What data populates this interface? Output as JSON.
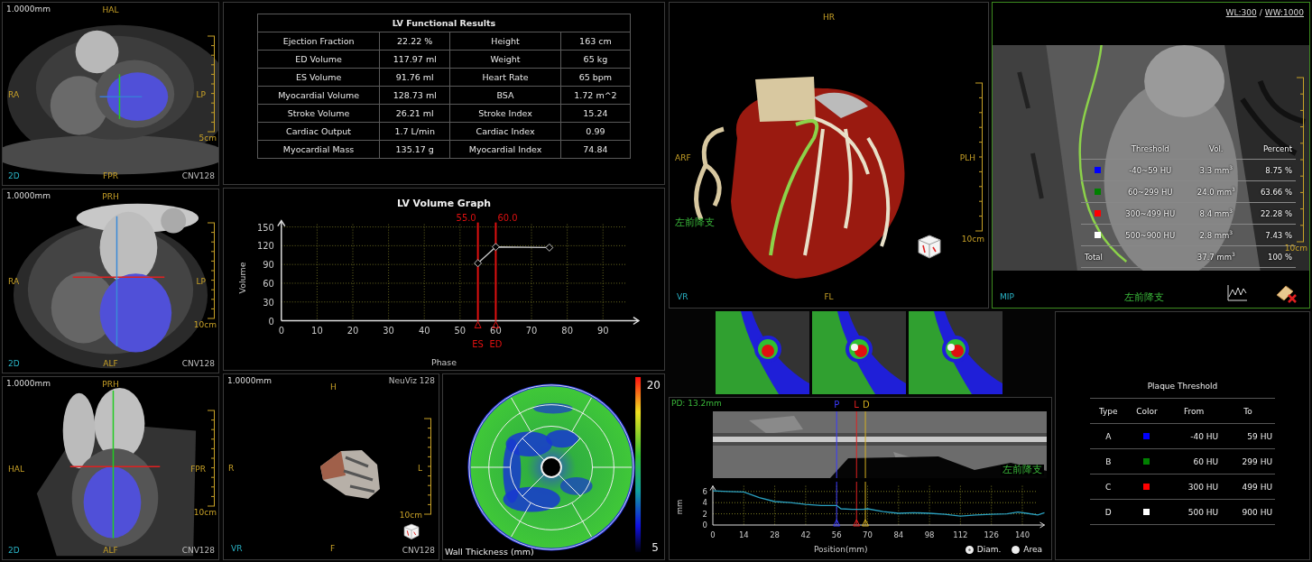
{
  "mpr_views": [
    {
      "kind": "short_axis",
      "spacing": "1.0000mm",
      "top": "HAL",
      "left": "RA",
      "right": "LP",
      "bottom": "FPR",
      "mode": "2D",
      "scanner": "CNV128",
      "ruler": "5cm"
    },
    {
      "kind": "four_chamber",
      "spacing": "1.0000mm",
      "top": "PRH",
      "left": "RA",
      "right": "LP",
      "bottom": "ALF",
      "mode": "2D",
      "scanner": "CNV128",
      "ruler": "10cm"
    },
    {
      "kind": "two_chamber",
      "spacing": "1.0000mm",
      "top": "PRH",
      "left": "HAL",
      "right": "FPR",
      "bottom": "ALF",
      "mode": "2D",
      "scanner": "CNV128",
      "ruler": "10cm"
    }
  ],
  "lv_results": {
    "title": "LV Functional Results",
    "rows": [
      [
        "Ejection Fraction",
        "22.22 %",
        "Height",
        "163 cm"
      ],
      [
        "ED Volume",
        "117.97 ml",
        "Weight",
        "65 kg"
      ],
      [
        "ES Volume",
        "91.76 ml",
        "Heart Rate",
        "65 bpm"
      ],
      [
        "Myocardial Volume",
        "128.73 ml",
        "BSA",
        "1.72 m^2"
      ],
      [
        "Stroke Volume",
        "26.21 ml",
        "Stroke Index",
        "15.24"
      ],
      [
        "Cardiac Output",
        "1.7 L/min",
        "Cardiac Index",
        "0.99"
      ],
      [
        "Myocardial Mass",
        "135.17 g",
        "Myocardial Index",
        "74.84"
      ]
    ]
  },
  "volume_graph": {
    "chart_data": {
      "type": "line",
      "title": "LV Volume Graph",
      "xlabel": "Phase",
      "ylabel": "Volume",
      "x": [
        55,
        60,
        75
      ],
      "series": [
        {
          "color": "#c8c8c8",
          "marker": "diamond",
          "values": [
            92,
            118,
            117
          ]
        }
      ],
      "xlim": [
        0,
        100
      ],
      "ylim": [
        0,
        160
      ],
      "xticks": [
        0,
        10,
        20,
        30,
        40,
        50,
        60,
        70,
        80,
        90
      ],
      "yticks": [
        0,
        30,
        60,
        90,
        120,
        150
      ],
      "grid": true,
      "ref_lines": [
        {
          "axis": "x",
          "value": 55,
          "label": "55.0",
          "color": "#e01010"
        },
        {
          "axis": "x",
          "value": 60,
          "label": "60.0",
          "color": "#e01010"
        }
      ],
      "annotations": [
        "ES",
        "ED"
      ]
    }
  },
  "vr_small": {
    "spacing": "1.0000mm",
    "scanner_model": "NeuViz 128",
    "top": "H",
    "left": "R",
    "right": "L",
    "bottom": "F",
    "mode": "VR",
    "scanner": "CNV128",
    "ruler": "10cm"
  },
  "bullseye": {
    "caption": "Wall Thickness (mm)",
    "scale_max": "20",
    "scale_min": "5"
  },
  "vr_main": {
    "top": "HR",
    "left": "ARF",
    "right": "PLH",
    "bottom": "FL",
    "mode": "VR",
    "vessel_label": "左前降支",
    "ruler": "10cm"
  },
  "mip": {
    "wl": "WL:300",
    "separator": "/",
    "ww": "WW:1000",
    "mode": "MIP",
    "vessel_label": "左前降支",
    "ruler": "10cm",
    "columns": [
      "Threshold",
      "Vol.",
      "Percent"
    ],
    "rows": [
      {
        "color": "#0000ff",
        "range": "-40~59 HU",
        "volume": "3.3 mm$^{3}$",
        "percent": "8.75 %"
      },
      {
        "color": "#008000",
        "range": "60~299 HU",
        "volume": "24.0 mm$^{3}$",
        "percent": "63.66 %"
      },
      {
        "color": "#ff0000",
        "range": "300~499 HU",
        "volume": "8.4 mm$^{3}$",
        "percent": "22.28 %"
      },
      {
        "color": "#ffffff",
        "range": "500~900 HU",
        "volume": "2.8 mm$^{3}$",
        "percent": "7.43 %"
      }
    ],
    "total": {
      "label": "Total",
      "volume": "37.7 mm$^{3}$",
      "percent": "100 %"
    }
  },
  "stretched_view": {
    "label": "PD: 13.2mm",
    "vessel_label": "左前降支"
  },
  "diameter_chart": {
    "chart_data": {
      "type": "line",
      "xlabel": "Position(mm)",
      "ylabel": "mm",
      "x": [
        0,
        7,
        14,
        21,
        28,
        35,
        42,
        49,
        56,
        58,
        63,
        68,
        70,
        77,
        84,
        91,
        98,
        105,
        112,
        119,
        126,
        133,
        138,
        142,
        147,
        150
      ],
      "series": [
        {
          "color": "#2aa0c0",
          "values": [
            6.1,
            6.0,
            5.9,
            4.9,
            4.2,
            4.0,
            3.7,
            3.5,
            3.5,
            2.9,
            2.8,
            2.8,
            2.9,
            2.4,
            2.1,
            2.2,
            2.1,
            1.9,
            1.6,
            1.8,
            1.9,
            2.0,
            2.3,
            2.1,
            1.8,
            2.2
          ]
        }
      ],
      "xlim": [
        0,
        150
      ],
      "ylim": [
        0,
        7
      ],
      "xticks": [
        0,
        14,
        28,
        42,
        56,
        70,
        84,
        98,
        112,
        126,
        140
      ],
      "yticks": [
        0,
        2,
        4,
        6
      ],
      "grid": true,
      "ref_lines": [
        {
          "axis": "x",
          "value": 56,
          "label": "P",
          "color": "#3a3aff"
        },
        {
          "axis": "x",
          "value": 65,
          "label": "L",
          "color": "#e02020"
        },
        {
          "axis": "x",
          "value": 69,
          "label": "D",
          "color": "#d4b020"
        }
      ]
    },
    "legend": [
      {
        "label": "Diam.",
        "selected": true
      },
      {
        "label": "Area",
        "selected": false
      }
    ]
  },
  "plaque_threshold": {
    "title": "Plaque Threshold",
    "columns": [
      "Type",
      "Color",
      "From",
      "To"
    ],
    "rows": [
      {
        "type": "A",
        "color": "#0000ff",
        "from": "-40 HU",
        "to": "59 HU"
      },
      {
        "type": "B",
        "color": "#008000",
        "from": "60 HU",
        "to": "299 HU"
      },
      {
        "type": "C",
        "color": "#ff0000",
        "from": "300 HU",
        "to": "499 HU"
      },
      {
        "type": "D",
        "color": "#ffffff",
        "from": "500 HU",
        "to": "900 HU"
      }
    ]
  }
}
